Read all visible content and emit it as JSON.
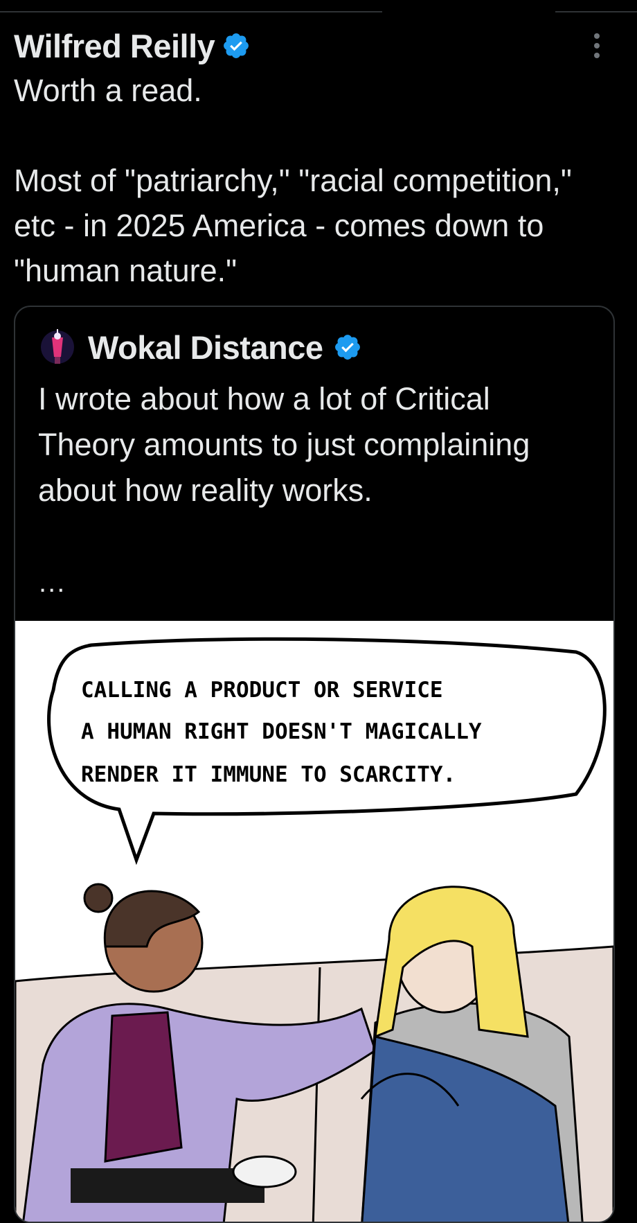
{
  "tweet": {
    "author_name": "Wilfred Reilly",
    "verified_icon": "verified-badge-icon",
    "more_icon": "more-options-icon",
    "text": "Worth a read.\n\nMost of \"patriarchy,\" \"racial competition,\" etc - in 2025 America - comes down to \"human nature.\""
  },
  "quote": {
    "author_name": "Wokal Distance",
    "avatar_icon": "avatar-lamp-icon",
    "verified_icon": "verified-badge-icon",
    "text": "I wrote about how a lot of Critical Theory amounts to just complaining about how reality works.",
    "ellipsis": "...",
    "image": {
      "speech_lines": [
        "CALLING A PRODUCT OR SERVICE",
        "A HUMAN RIGHT DOESN'T MAGICALLY",
        "RENDER IT IMMUNE TO SCARCITY."
      ]
    }
  },
  "colors": {
    "background": "#000000",
    "text": "#e7e9ea",
    "verified": "#1d9bf0",
    "border": "#2f3336"
  }
}
